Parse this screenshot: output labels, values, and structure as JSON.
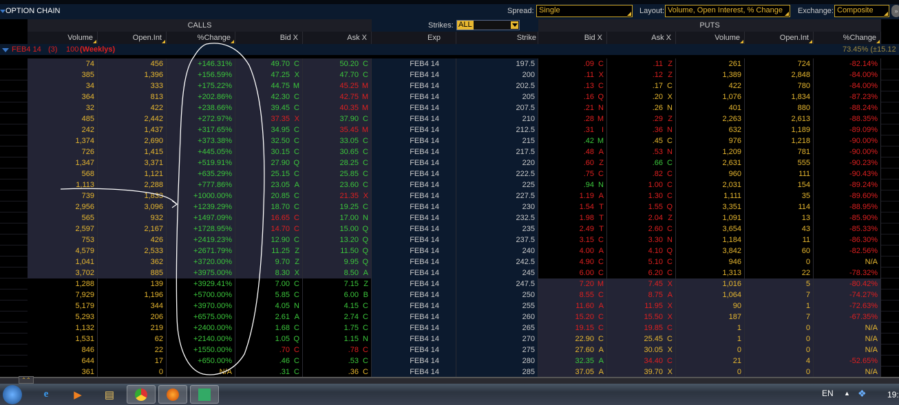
{
  "window": {
    "title": "OPTION CHAIN"
  },
  "toolbar": {
    "spread_label": "Spread:",
    "spread_value": "Single",
    "layout_label": "Layout:",
    "layout_value": "Volume, Open Interest, % Change",
    "exchange_label": "Exchange:",
    "exchange_value": "Composite",
    "strikes_label": "Strikes:",
    "strikes_value": "ALL"
  },
  "sections": {
    "calls": "CALLS",
    "puts": "PUTS"
  },
  "columns": {
    "call_volume": "Volume",
    "call_oi": "Open.Int",
    "call_change": "%Change",
    "call_bid": "Bid X",
    "call_ask": "Ask X",
    "exp": "Exp",
    "strike": "Strike",
    "put_bid": "Bid X",
    "put_ask": "Ask X",
    "put_volume": "Volume",
    "put_oi": "Open.Int",
    "put_change": "%Change"
  },
  "group": {
    "expiry": "FEB4 14",
    "days": "(3)",
    "multiplier": "100",
    "type": "(Weeklys)",
    "iv": "73.45% (±15.12"
  },
  "colors": {
    "green": "#3cc83c",
    "red": "#e02020",
    "yellow": "#e8b830",
    "itm_bg": "#232435",
    "otm_bg": "#000000",
    "mid_bg": "#0c1a2e"
  },
  "rows": [
    {
      "exp": "FEB4 14",
      "strike": "197.5",
      "itm": "call",
      "cv": "74",
      "coi": "456",
      "cch": "+146.31%",
      "cb": [
        "49.70",
        "C",
        "g"
      ],
      "ca": [
        "50.20",
        "C",
        "g"
      ],
      "pb": [
        ".09",
        "C",
        "r"
      ],
      "pa": [
        ".11",
        "Z",
        "r"
      ],
      "pv": "261",
      "poi": "724",
      "pch": "-82.14%"
    },
    {
      "exp": "FEB4 14",
      "strike": "200",
      "itm": "call",
      "cv": "385",
      "coi": "1,396",
      "cch": "+156.59%",
      "cb": [
        "47.25",
        "X",
        "g"
      ],
      "ca": [
        "47.70",
        "C",
        "g"
      ],
      "pb": [
        ".11",
        "X",
        "r"
      ],
      "pa": [
        ".12",
        "Z",
        "r"
      ],
      "pv": "1,389",
      "poi": "2,848",
      "pch": "-84.00%"
    },
    {
      "exp": "FEB4 14",
      "strike": "202.5",
      "itm": "call",
      "cv": "34",
      "coi": "333",
      "cch": "+175.22%",
      "cb": [
        "44.75",
        "M",
        "g"
      ],
      "ca": [
        "45.25",
        "M",
        "r"
      ],
      "pb": [
        ".13",
        "C",
        "r"
      ],
      "pa": [
        ".17",
        "C",
        "y"
      ],
      "pv": "422",
      "poi": "780",
      "pch": "-84.00%"
    },
    {
      "exp": "FEB4 14",
      "strike": "205",
      "itm": "call",
      "cv": "364",
      "coi": "813",
      "cch": "+202.86%",
      "cb": [
        "42.30",
        "C",
        "g"
      ],
      "ca": [
        "42.75",
        "M",
        "r"
      ],
      "pb": [
        ".16",
        "Q",
        "r"
      ],
      "pa": [
        ".20",
        "X",
        "y"
      ],
      "pv": "1,076",
      "poi": "1,834",
      "pch": "-87.23%"
    },
    {
      "exp": "FEB4 14",
      "strike": "207.5",
      "itm": "call",
      "cv": "32",
      "coi": "422",
      "cch": "+238.66%",
      "cb": [
        "39.45",
        "C",
        "g"
      ],
      "ca": [
        "40.35",
        "M",
        "r"
      ],
      "pb": [
        ".21",
        "N",
        "r"
      ],
      "pa": [
        ".26",
        "N",
        "y"
      ],
      "pv": "401",
      "poi": "880",
      "pch": "-88.24%"
    },
    {
      "exp": "FEB4 14",
      "strike": "210",
      "itm": "call",
      "cv": "485",
      "coi": "2,442",
      "cch": "+272.97%",
      "cb": [
        "37.35",
        "X",
        "r"
      ],
      "ca": [
        "37.90",
        "C",
        "g"
      ],
      "pb": [
        ".28",
        "M",
        "r"
      ],
      "pa": [
        ".29",
        "Z",
        "r"
      ],
      "pv": "2,263",
      "poi": "2,613",
      "pch": "-88.35%"
    },
    {
      "exp": "FEB4 14",
      "strike": "212.5",
      "itm": "call",
      "cv": "242",
      "coi": "1,437",
      "cch": "+317.65%",
      "cb": [
        "34.95",
        "C",
        "g"
      ],
      "ca": [
        "35.45",
        "M",
        "r"
      ],
      "pb": [
        ".31",
        "I",
        "r"
      ],
      "pa": [
        ".36",
        "N",
        "r"
      ],
      "pv": "632",
      "poi": "1,189",
      "pch": "-89.09%"
    },
    {
      "exp": "FEB4 14",
      "strike": "215",
      "itm": "call",
      "cv": "1,374",
      "coi": "2,690",
      "cch": "+373.38%",
      "cb": [
        "32.50",
        "C",
        "g"
      ],
      "ca": [
        "33.05",
        "C",
        "g"
      ],
      "pb": [
        ".42",
        "M",
        "g"
      ],
      "pa": [
        ".45",
        "C",
        "y"
      ],
      "pv": "976",
      "poi": "1,218",
      "pch": "-90.00%"
    },
    {
      "exp": "FEB4 14",
      "strike": "217.5",
      "itm": "call",
      "cv": "726",
      "coi": "1,415",
      "cch": "+445.05%",
      "cb": [
        "30.15",
        "C",
        "g"
      ],
      "ca": [
        "30.65",
        "C",
        "g"
      ],
      "pb": [
        ".48",
        "A",
        "r"
      ],
      "pa": [
        ".53",
        "N",
        "r"
      ],
      "pv": "1,209",
      "poi": "781",
      "pch": "-90.00%"
    },
    {
      "exp": "FEB4 14",
      "strike": "220",
      "itm": "call",
      "cv": "1,347",
      "coi": "3,371",
      "cch": "+519.91%",
      "cb": [
        "27.90",
        "Q",
        "g"
      ],
      "ca": [
        "28.25",
        "C",
        "g"
      ],
      "pb": [
        ".60",
        "Z",
        "r"
      ],
      "pa": [
        ".66",
        "C",
        "g"
      ],
      "pv": "2,631",
      "poi": "555",
      "pch": "-90.23%"
    },
    {
      "exp": "FEB4 14",
      "strike": "222.5",
      "itm": "call",
      "cv": "568",
      "coi": "1,121",
      "cch": "+635.29%",
      "cb": [
        "25.15",
        "C",
        "g"
      ],
      "ca": [
        "25.85",
        "C",
        "g"
      ],
      "pb": [
        ".75",
        "C",
        "r"
      ],
      "pa": [
        ".82",
        "C",
        "r"
      ],
      "pv": "960",
      "poi": "111",
      "pch": "-90.43%"
    },
    {
      "exp": "FEB4 14",
      "strike": "225",
      "itm": "call",
      "cv": "1,113",
      "coi": "2,288",
      "cch": "+777.86%",
      "cb": [
        "23.05",
        "A",
        "g"
      ],
      "ca": [
        "23.60",
        "C",
        "g"
      ],
      "pb": [
        ".94",
        "N",
        "g"
      ],
      "pa": [
        "1.00",
        "C",
        "r"
      ],
      "pv": "2,031",
      "poi": "154",
      "pch": "-89.24%"
    },
    {
      "exp": "FEB4 14",
      "strike": "227.5",
      "itm": "call",
      "cv": "739",
      "coi": "1,833",
      "cch": "+1000.00%",
      "cb": [
        "20.85",
        "C",
        "g"
      ],
      "ca": [
        "21.35",
        "X",
        "r"
      ],
      "pb": [
        "1.19",
        "A",
        "r"
      ],
      "pa": [
        "1.30",
        "C",
        "r"
      ],
      "pv": "1,111",
      "poi": "35",
      "pch": "-89.60%"
    },
    {
      "exp": "FEB4 14",
      "strike": "230",
      "itm": "call",
      "cv": "2,956",
      "coi": "3,096",
      "cch": "+1239.29%",
      "cb": [
        "18.70",
        "C",
        "g"
      ],
      "ca": [
        "19.25",
        "C",
        "g"
      ],
      "pb": [
        "1.54",
        "T",
        "r"
      ],
      "pa": [
        "1.55",
        "Q",
        "r"
      ],
      "pv": "3,351",
      "poi": "114",
      "pch": "-88.95%"
    },
    {
      "exp": "FEB4 14",
      "strike": "232.5",
      "itm": "call",
      "cv": "565",
      "coi": "932",
      "cch": "+1497.09%",
      "cb": [
        "16.65",
        "C",
        "r"
      ],
      "ca": [
        "17.00",
        "N",
        "g"
      ],
      "pb": [
        "1.98",
        "T",
        "r"
      ],
      "pa": [
        "2.04",
        "Z",
        "r"
      ],
      "pv": "1,091",
      "poi": "13",
      "pch": "-85.90%"
    },
    {
      "exp": "FEB4 14",
      "strike": "235",
      "itm": "call",
      "cv": "2,597",
      "coi": "2,167",
      "cch": "+1728.95%",
      "cb": [
        "14.70",
        "C",
        "r"
      ],
      "ca": [
        "15.00",
        "Q",
        "g"
      ],
      "pb": [
        "2.49",
        "T",
        "r"
      ],
      "pa": [
        "2.60",
        "C",
        "r"
      ],
      "pv": "3,654",
      "poi": "43",
      "pch": "-85.33%"
    },
    {
      "exp": "FEB4 14",
      "strike": "237.5",
      "itm": "call",
      "cv": "753",
      "coi": "426",
      "cch": "+2419.23%",
      "cb": [
        "12.90",
        "C",
        "g"
      ],
      "ca": [
        "13.20",
        "Q",
        "g"
      ],
      "pb": [
        "3.15",
        "C",
        "r"
      ],
      "pa": [
        "3.30",
        "N",
        "r"
      ],
      "pv": "1,184",
      "poi": "11",
      "pch": "-86.30%"
    },
    {
      "exp": "FEB4 14",
      "strike": "240",
      "itm": "call",
      "cv": "4,579",
      "coi": "2,533",
      "cch": "+2671.79%",
      "cb": [
        "11.25",
        "Z",
        "g"
      ],
      "ca": [
        "11.50",
        "Q",
        "g"
      ],
      "pb": [
        "4.00",
        "A",
        "r"
      ],
      "pa": [
        "4.10",
        "Q",
        "r"
      ],
      "pv": "3,842",
      "poi": "60",
      "pch": "-82.56%"
    },
    {
      "exp": "FEB4 14",
      "strike": "242.5",
      "itm": "call",
      "cv": "1,041",
      "coi": "362",
      "cch": "+3720.00%",
      "cb": [
        "9.70",
        "Z",
        "g"
      ],
      "ca": [
        "9.95",
        "Q",
        "g"
      ],
      "pb": [
        "4.90",
        "C",
        "r"
      ],
      "pa": [
        "5.10",
        "C",
        "r"
      ],
      "pv": "946",
      "poi": "0",
      "pch": "N/A"
    },
    {
      "exp": "FEB4 14",
      "strike": "245",
      "itm": "call",
      "cv": "3,702",
      "coi": "885",
      "cch": "+3975.00%",
      "cb": [
        "8.30",
        "X",
        "g"
      ],
      "ca": [
        "8.50",
        "A",
        "g"
      ],
      "pb": [
        "6.00",
        "C",
        "r"
      ],
      "pa": [
        "6.20",
        "C",
        "r"
      ],
      "pv": "1,313",
      "poi": "22",
      "pch": "-78.32%"
    },
    {
      "exp": "FEB4 14",
      "strike": "247.5",
      "itm": "put",
      "cv": "1,288",
      "coi": "139",
      "cch": "+3929.41%",
      "cb": [
        "7.00",
        "C",
        "g"
      ],
      "ca": [
        "7.15",
        "Z",
        "g"
      ],
      "pb": [
        "7.20",
        "M",
        "r"
      ],
      "pa": [
        "7.45",
        "X",
        "r"
      ],
      "pv": "1,016",
      "poi": "5",
      "pch": "-80.42%"
    },
    {
      "exp": "FEB4 14",
      "strike": "250",
      "itm": "put",
      "cv": "7,929",
      "coi": "1,196",
      "cch": "+5700.00%",
      "cb": [
        "5.85",
        "C",
        "g"
      ],
      "ca": [
        "6.00",
        "B",
        "g"
      ],
      "pb": [
        "8.55",
        "C",
        "r"
      ],
      "pa": [
        "8.75",
        "A",
        "r"
      ],
      "pv": "1,064",
      "poi": "7",
      "pch": "-74.27%"
    },
    {
      "exp": "FEB4 14",
      "strike": "255",
      "itm": "put",
      "cv": "5,179",
      "coi": "344",
      "cch": "+3970.00%",
      "cb": [
        "4.05",
        "N",
        "g"
      ],
      "ca": [
        "4.15",
        "C",
        "g"
      ],
      "pb": [
        "11.60",
        "A",
        "r"
      ],
      "pa": [
        "11.95",
        "X",
        "r"
      ],
      "pv": "90",
      "poi": "1",
      "pch": "-72.63%"
    },
    {
      "exp": "FEB4 14",
      "strike": "260",
      "itm": "put",
      "cv": "5,293",
      "coi": "206",
      "cch": "+6575.00%",
      "cb": [
        "2.61",
        "A",
        "g"
      ],
      "ca": [
        "2.74",
        "C",
        "g"
      ],
      "pb": [
        "15.20",
        "C",
        "r"
      ],
      "pa": [
        "15.50",
        "X",
        "r"
      ],
      "pv": "187",
      "poi": "7",
      "pch": "-67.35%"
    },
    {
      "exp": "FEB4 14",
      "strike": "265",
      "itm": "put",
      "cv": "1,132",
      "coi": "219",
      "cch": "+2400.00%",
      "cb": [
        "1.68",
        "C",
        "g"
      ],
      "ca": [
        "1.75",
        "C",
        "g"
      ],
      "pb": [
        "19.15",
        "C",
        "r"
      ],
      "pa": [
        "19.85",
        "C",
        "r"
      ],
      "pv": "1",
      "poi": "0",
      "pch": "N/A"
    },
    {
      "exp": "FEB4 14",
      "strike": "270",
      "itm": "put",
      "cv": "1,531",
      "coi": "62",
      "cch": "+2140.00%",
      "cb": [
        "1.05",
        "Q",
        "g"
      ],
      "ca": [
        "1.15",
        "N",
        "g"
      ],
      "pb": [
        "22.90",
        "C",
        "y"
      ],
      "pa": [
        "25.45",
        "C",
        "y"
      ],
      "pv": "1",
      "poi": "0",
      "pch": "N/A"
    },
    {
      "exp": "FEB4 14",
      "strike": "275",
      "itm": "put",
      "cv": "846",
      "coi": "22",
      "cch": "+1550.00%",
      "cb": [
        ".70",
        "C",
        "r"
      ],
      "ca": [
        ".78",
        "C",
        "r"
      ],
      "pb": [
        "27.60",
        "A",
        "y"
      ],
      "pa": [
        "30.05",
        "X",
        "y"
      ],
      "pv": "0",
      "poi": "0",
      "pch": "N/A"
    },
    {
      "exp": "FEB4 14",
      "strike": "280",
      "itm": "put",
      "cv": "644",
      "coi": "17",
      "cch": "+650.00%",
      "cb": [
        ".46",
        "C",
        "g"
      ],
      "ca": [
        ".53",
        "C",
        "g"
      ],
      "pb": [
        "32.35",
        "A",
        "g"
      ],
      "pa": [
        "34.40",
        "C",
        "r"
      ],
      "pv": "21",
      "poi": "4",
      "pch": "-52.65%"
    },
    {
      "exp": "FEB4 14",
      "strike": "285",
      "itm": "put",
      "cv": "361",
      "coi": "0",
      "cch": "N/A",
      "cb": [
        ".31",
        "C",
        "g"
      ],
      "ca": [
        ".36",
        "C",
        "y"
      ],
      "pb": [
        "37.05",
        "A",
        "y"
      ],
      "pa": [
        "39.70",
        "X",
        "y"
      ],
      "pv": "0",
      "poi": "0",
      "pch": "N/A"
    }
  ],
  "taskbar": {
    "language": "EN",
    "clock": "19:",
    "apps": [
      "start-orb",
      "internet-explorer",
      "media-player",
      "file-explorer",
      "chrome",
      "firefox",
      "trading-app"
    ]
  }
}
